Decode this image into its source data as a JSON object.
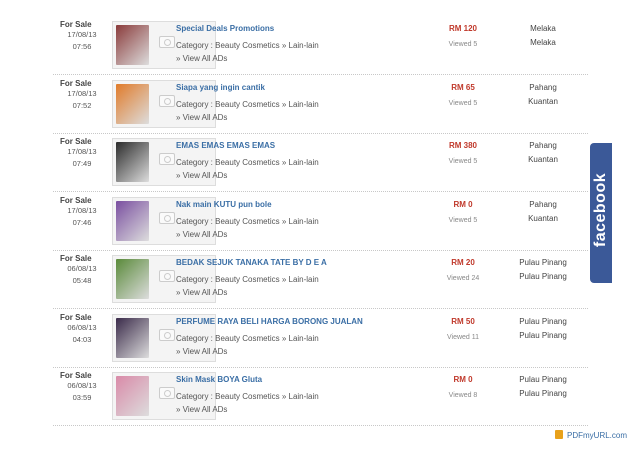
{
  "listings": [
    {
      "type": "For Sale",
      "date": "17/08/13",
      "time": "07:56",
      "title": "Special Deals Promotions",
      "category": "Category : Beauty Cosmetics » Lain-lain",
      "view_all": "» View All ADs",
      "price": "RM 120",
      "views": "Viewed 5",
      "state": "Melaka",
      "city": "Melaka",
      "thumb_color": "#8a3b3b"
    },
    {
      "type": "For Sale",
      "date": "17/08/13",
      "time": "07:52",
      "title": "Siapa yang ingin cantik",
      "category": "Category : Beauty Cosmetics » Lain-lain",
      "view_all": "» View All ADs",
      "price": "RM 65",
      "views": "Viewed 5",
      "state": "Pahang",
      "city": "Kuantan",
      "thumb_color": "#e07b2a"
    },
    {
      "type": "For Sale",
      "date": "17/08/13",
      "time": "07:49",
      "title": "EMAS EMAS EMAS EMAS",
      "category": "Category : Beauty Cosmetics » Lain-lain",
      "view_all": "» View All ADs",
      "price": "RM 380",
      "views": "Viewed 5",
      "state": "Pahang",
      "city": "Kuantan",
      "thumb_color": "#2b2b2b"
    },
    {
      "type": "For Sale",
      "date": "17/08/13",
      "time": "07:46",
      "title": "Nak main KUTU pun bole",
      "category": "Category : Beauty Cosmetics » Lain-lain",
      "view_all": "» View All ADs",
      "price": "RM 0",
      "views": "Viewed 5",
      "state": "Pahang",
      "city": "Kuantan",
      "thumb_color": "#7a4fa0"
    },
    {
      "type": "For Sale",
      "date": "06/08/13",
      "time": "05:48",
      "title": "BEDAK SEJUK TANAKA TATE BY D E A",
      "category": "Category : Beauty Cosmetics » Lain-lain",
      "view_all": "» View All ADs",
      "price": "RM 20",
      "views": "Viewed 24",
      "state": "Pulau Pinang",
      "city": "Pulau Pinang",
      "thumb_color": "#5a8a3a"
    },
    {
      "type": "For Sale",
      "date": "06/08/13",
      "time": "04:03",
      "title": "PERFUME RAYA BELI HARGA BORONG JUALAN",
      "category": "Category : Beauty Cosmetics » Lain-lain",
      "view_all": "» View All ADs",
      "price": "RM 50",
      "views": "Viewed 11",
      "state": "Pulau Pinang",
      "city": "Pulau Pinang",
      "thumb_color": "#3a2a4a"
    },
    {
      "type": "For Sale",
      "date": "06/08/13",
      "time": "03:59",
      "title": "Skin Mask BOYA Gluta",
      "category": "Category : Beauty Cosmetics » Lain-lain",
      "view_all": "» View All ADs",
      "price": "RM 0",
      "views": "Viewed 8",
      "state": "Pulau Pinang",
      "city": "Pulau Pinang",
      "thumb_color": "#d98aa8"
    }
  ],
  "facebook_tab": {
    "label": "facebook",
    "color": "#3b5998"
  },
  "pdf_badge": {
    "label": "PDFmyURL.com"
  },
  "accent_color": "#3a6ea5",
  "price_color": "#c0392b"
}
